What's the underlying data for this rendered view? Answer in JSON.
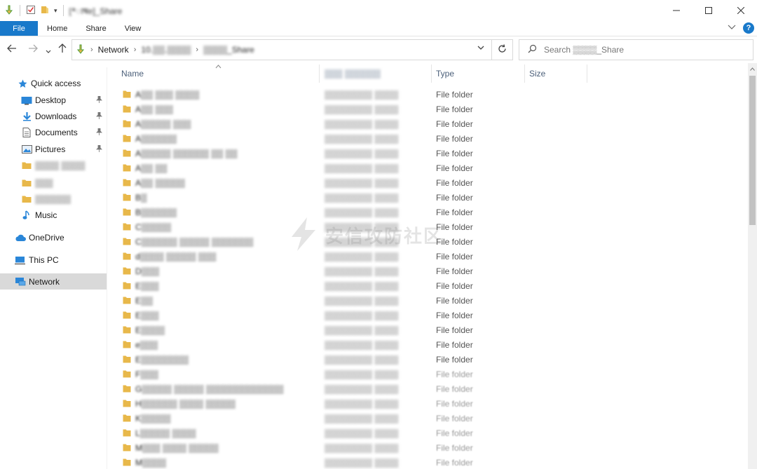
{
  "window": {
    "title": "[*ाषe]_Share",
    "controls": [
      "minimize-icon",
      "maximize-icon",
      "close-icon"
    ]
  },
  "ribbon": {
    "tabs": [
      {
        "label": "File",
        "active": true
      },
      {
        "label": "Home"
      },
      {
        "label": "Share"
      },
      {
        "label": "View"
      }
    ],
    "help_label": "?"
  },
  "address": {
    "crumbs": [
      "Network",
      "10.▒▒.▒▒▒▒",
      "▒▒▒▒_Share"
    ]
  },
  "search": {
    "placeholder": "Search ▒▒▒▒_Share"
  },
  "sidebar": {
    "items": [
      {
        "label": "Quick access",
        "icon": "star-icon"
      },
      {
        "label": "Desktop",
        "icon": "desktop-icon",
        "pinned": true
      },
      {
        "label": "Downloads",
        "icon": "download-icon",
        "pinned": true
      },
      {
        "label": "Documents",
        "icon": "documents-icon",
        "pinned": true
      },
      {
        "label": "Pictures",
        "icon": "pictures-icon",
        "pinned": true
      },
      {
        "label": "▒▒▒▒ ▒▒▒▒",
        "icon": "folder-icon",
        "blurred": true
      },
      {
        "label": "▒▒▒",
        "icon": "folder-icon",
        "blurred": true
      },
      {
        "label": "▒▒▒▒▒▒",
        "icon": "folder-icon",
        "blurred": true
      },
      {
        "label": "Music",
        "icon": "music-icon"
      },
      {
        "label": "OneDrive",
        "icon": "cloud-icon"
      },
      {
        "label": "This PC",
        "icon": "computer-icon"
      },
      {
        "label": "Network",
        "icon": "network-icon",
        "selected": true
      }
    ]
  },
  "columns": {
    "name": "Name",
    "date": "▒▒▒ ▒▒▒▒▒▒",
    "type": "Type",
    "size": "Size"
  },
  "files": [
    {
      "name": "A▒▒ ▒▒▒ ▒▒▒▒",
      "date": "▒▒▒▒▒▒▒▒ ▒▒▒▒",
      "type": "File folder"
    },
    {
      "name": "A▒▒ ▒▒▒",
      "date": "▒▒▒▒▒▒▒▒ ▒▒▒▒",
      "type": "File folder"
    },
    {
      "name": "A▒▒▒▒▒ ▒▒▒",
      "date": "▒▒▒▒▒▒▒▒ ▒▒▒▒",
      "type": "File folder"
    },
    {
      "name": "A▒▒▒▒▒▒",
      "date": "▒▒▒▒▒▒▒▒ ▒▒▒▒",
      "type": "File folder"
    },
    {
      "name": "A▒▒▒▒▒ ▒▒▒▒▒▒ ▒▒ ▒▒",
      "date": "▒▒▒▒▒▒▒▒ ▒▒▒▒",
      "type": "File folder"
    },
    {
      "name": "A▒▒ ▒▒",
      "date": "▒▒▒▒▒▒▒▒ ▒▒▒▒",
      "type": "File folder"
    },
    {
      "name": "A▒▒ ▒▒▒▒▒",
      "date": "▒▒▒▒▒▒▒▒ ▒▒▒▒",
      "type": "File folder"
    },
    {
      "name": "B▒",
      "date": "▒▒▒▒▒▒▒▒ ▒▒▒▒",
      "type": "File folder"
    },
    {
      "name": "B▒▒▒▒▒▒",
      "date": "▒▒▒▒▒▒▒▒ ▒▒▒▒",
      "type": "File folder"
    },
    {
      "name": "C▒▒▒▒▒",
      "date": "▒▒▒▒▒▒▒▒ ▒▒▒▒",
      "type": "File folder"
    },
    {
      "name": "C▒▒▒▒▒▒ ▒▒▒▒▒ ▒▒▒▒▒▒▒",
      "date": "▒▒▒▒▒▒▒▒ ▒▒▒▒",
      "type": "File folder"
    },
    {
      "name": "d▒▒▒▒ ▒▒▒▒▒ ▒▒▒",
      "date": "▒▒▒▒▒▒▒▒ ▒▒▒▒",
      "type": "File folder"
    },
    {
      "name": "D▒▒▒",
      "date": "▒▒▒▒▒▒▒▒ ▒▒▒▒",
      "type": "File folder"
    },
    {
      "name": "E▒▒▒",
      "date": "▒▒▒▒▒▒▒▒ ▒▒▒▒",
      "type": "File folder"
    },
    {
      "name": "E▒▒",
      "date": "▒▒▒▒▒▒▒▒ ▒▒▒▒",
      "type": "File folder"
    },
    {
      "name": "E▒▒▒",
      "date": "▒▒▒▒▒▒▒▒ ▒▒▒▒",
      "type": "File folder"
    },
    {
      "name": "E▒▒▒▒",
      "date": "▒▒▒▒▒▒▒▒ ▒▒▒▒",
      "type": "File folder"
    },
    {
      "name": "e▒▒▒",
      "date": "▒▒▒▒▒▒▒▒ ▒▒▒▒",
      "type": "File folder"
    },
    {
      "name": "E▒▒▒▒▒▒▒▒",
      "date": "▒▒▒▒▒▒▒▒ ▒▒▒▒",
      "type": "File folder"
    },
    {
      "name": "F▒▒▒",
      "date": "▒▒▒▒▒▒▒▒ ▒▒▒▒",
      "type": "File folder",
      "faded": true
    },
    {
      "name": "G▒▒▒▒▒ ▒▒▒▒▒ ▒▒▒▒▒▒▒▒▒▒▒▒▒",
      "date": "▒▒▒▒▒▒▒▒ ▒▒▒▒",
      "type": "File folder",
      "faded": true
    },
    {
      "name": "H▒▒▒▒▒▒ ▒▒▒▒ ▒▒▒▒▒",
      "date": "▒▒▒▒▒▒▒▒ ▒▒▒▒",
      "type": "File folder",
      "faded": true
    },
    {
      "name": "K▒▒▒▒▒",
      "date": "▒▒▒▒▒▒▒▒ ▒▒▒▒",
      "type": "File folder",
      "faded": true
    },
    {
      "name": "L▒▒▒▒▒ ▒▒▒▒",
      "date": "▒▒▒▒▒▒▒▒ ▒▒▒▒",
      "type": "File folder",
      "faded": true
    },
    {
      "name": "M▒▒▒ ▒▒▒▒ ▒▒▒▒▒",
      "date": "▒▒▒▒▒▒▒▒ ▒▒▒▒",
      "type": "File folder",
      "faded": true
    },
    {
      "name": "M▒▒▒▒",
      "date": "▒▒▒▒▒▒▒▒ ▒▒▒▒",
      "type": "File folder",
      "faded": true
    }
  ],
  "watermark": {
    "text": "安信攻防社区"
  },
  "colors": {
    "accent": "#1979ca",
    "folder": "#e8b84a",
    "selected_nav": "#d9d9d9"
  }
}
